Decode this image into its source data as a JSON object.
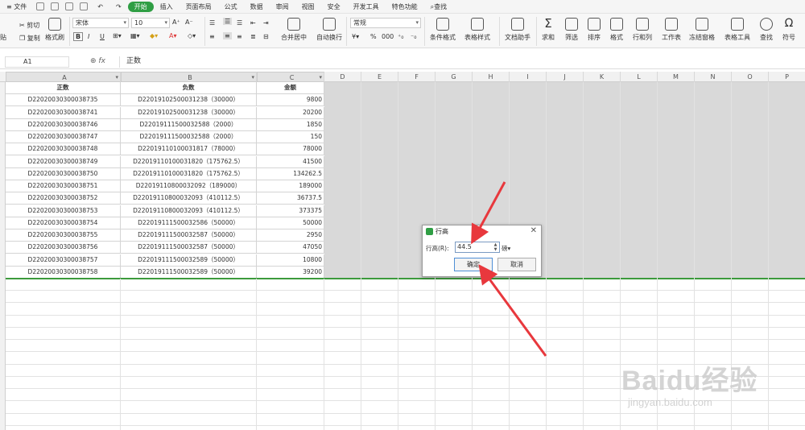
{
  "menubar": {
    "file": "文件",
    "tabs": [
      "开始",
      "插入",
      "页面布局",
      "公式",
      "数据",
      "审阅",
      "视图",
      "安全",
      "开发工具",
      "特色功能"
    ],
    "active_tab": "开始",
    "search": "查找"
  },
  "ribbon": {
    "paste": "贴",
    "cut": "剪切",
    "copy": "复制",
    "format_painter": "格式刷",
    "font_name": "宋体",
    "font_size": "10",
    "bold": "B",
    "italic": "I",
    "underline": "U",
    "merge_center": "合并居中",
    "wrap_text": "自动换行",
    "number_format": "常规",
    "percent": "%",
    "thousands": "000",
    "cond_format": "条件格式",
    "table_style": "表格样式",
    "doc_helper": "文档助手",
    "sum": "求和",
    "filter": "筛选",
    "sort": "排序",
    "format": "格式",
    "row_col": "行和列",
    "worksheet": "工作表",
    "freeze": "冻结窗格",
    "table_tools": "表格工具",
    "find": "查找",
    "symbol": "符号"
  },
  "formula_bar": {
    "cell_ref": "A1",
    "fx": "fx",
    "content": "正数"
  },
  "grid": {
    "columns": [
      "A",
      "B",
      "C",
      "D",
      "E",
      "F",
      "G",
      "H",
      "I",
      "J",
      "K",
      "L",
      "M",
      "N",
      "O",
      "P"
    ],
    "header": [
      "正数",
      "负数",
      "金额"
    ],
    "rows": [
      [
        "D22020030300038735",
        "D22019102500031238（30000）",
        "9800"
      ],
      [
        "D22020030300038741",
        "D22019102500031238（30000）",
        "20200"
      ],
      [
        "D22020030300038746",
        "D22019111500032588（2000）",
        "1850"
      ],
      [
        "D22020030300038747",
        "D22019111500032588（2000）",
        "150"
      ],
      [
        "D22020030300038748",
        "D22019110100031817（78000）",
        "78000"
      ],
      [
        "D22020030300038749",
        "D22019110100031820（175762.5）",
        "41500"
      ],
      [
        "D22020030300038750",
        "D22019110100031820（175762.5）",
        "134262.5"
      ],
      [
        "D22020030300038751",
        "D22019110800032092（189000）",
        "189000"
      ],
      [
        "D22020030300038752",
        "D22019110800032093（410112.5）",
        "36737.5"
      ],
      [
        "D22020030300038753",
        "D22019110800032093（410112.5）",
        "373375"
      ],
      [
        "D22020030300038754",
        "D22019111500032586（50000）",
        "50000"
      ],
      [
        "D22020030300038755",
        "D22019111500032587（50000）",
        "2950"
      ],
      [
        "D22020030300038756",
        "D22019111500032587（50000）",
        "47050"
      ],
      [
        "D22020030300038757",
        "D22019111500032589（50000）",
        "10800"
      ],
      [
        "D22020030300038758",
        "D22019111500032589（50000）",
        "39200"
      ]
    ]
  },
  "dialog": {
    "title": "行高",
    "label": "行高(R):",
    "value": "44.5",
    "unit": "磅▾",
    "ok": "确定",
    "cancel": "取消"
  },
  "watermark": {
    "brand": "Baidu经验",
    "url": "jingyan.baidu.com"
  },
  "colors": {
    "accent_green": "#2f9e44",
    "arrow_red": "#e8383d",
    "selection_border": "#3c9a3c"
  }
}
